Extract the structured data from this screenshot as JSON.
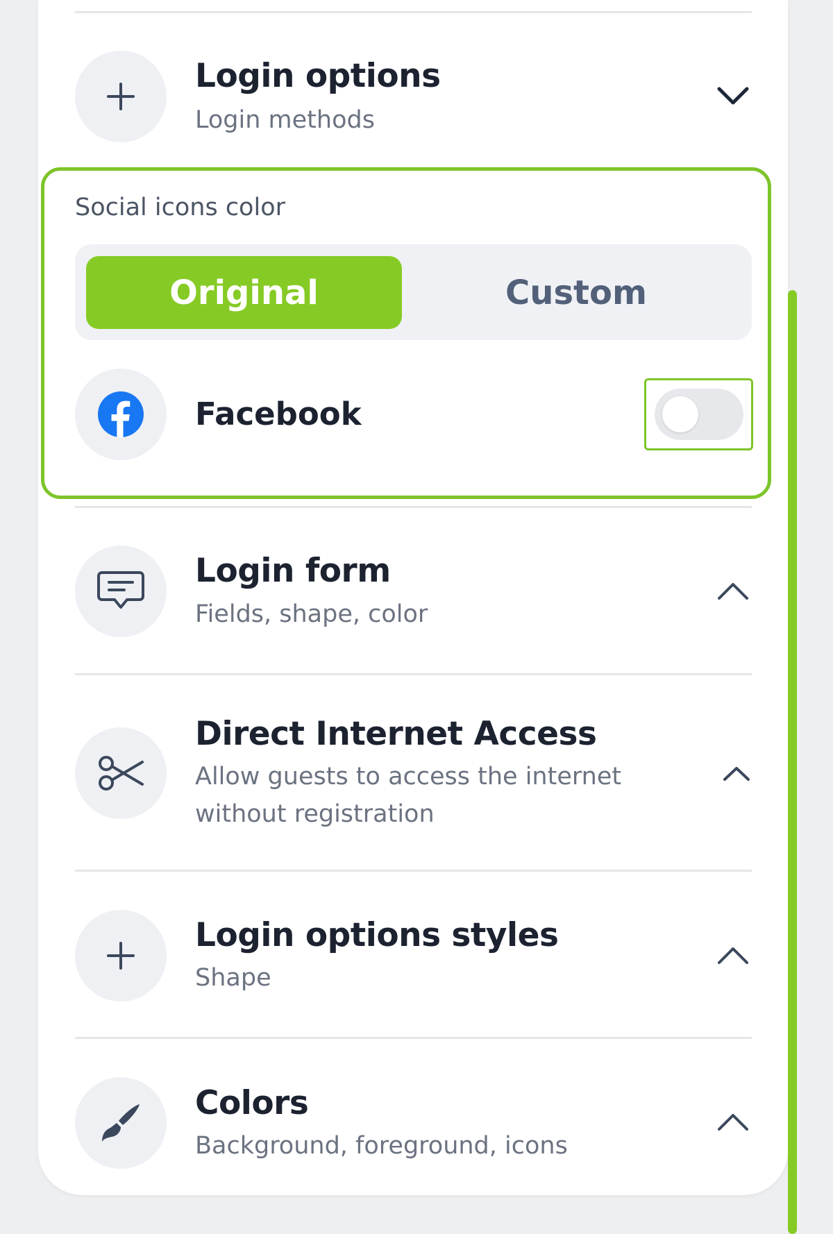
{
  "sections": [
    {
      "id": "login-options",
      "title": "Login options",
      "subtitle": "Login methods",
      "icon": "plus-icon",
      "expanded": true
    },
    {
      "id": "login-form",
      "title": "Login form",
      "subtitle": "Fields, shape, color",
      "icon": "message-icon",
      "expanded": false
    },
    {
      "id": "direct-internet-access",
      "title": "Direct Internet Access",
      "subtitle": "Allow guests to access the internet without registration",
      "icon": "scissors-icon",
      "expanded": false
    },
    {
      "id": "login-options-styles",
      "title": "Login options styles",
      "subtitle": "Shape",
      "icon": "plus-icon",
      "expanded": false
    },
    {
      "id": "colors",
      "title": "Colors",
      "subtitle": "Background, foreground, icons",
      "icon": "brush-icon",
      "expanded": false
    }
  ],
  "social_icons": {
    "label": "Social icons color",
    "options": [
      "Original",
      "Custom"
    ],
    "selected": "Original",
    "providers": [
      {
        "name": "Facebook",
        "icon": "facebook-icon",
        "enabled": false
      }
    ]
  },
  "colors": {
    "accent": "#86cb25",
    "highlight_border": "#7dc42a",
    "facebook": "#1877f2",
    "text": "#1c2230",
    "muted": "#6b7280"
  }
}
